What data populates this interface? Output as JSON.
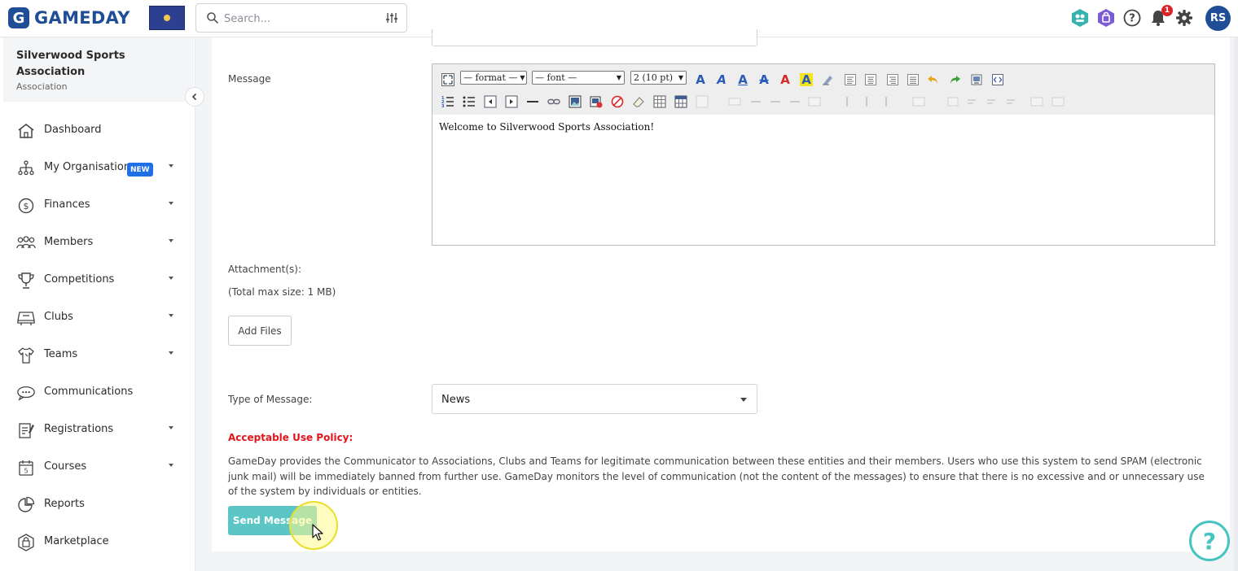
{
  "app": {
    "brand": "GAMEDAY",
    "search_placeholder": "Search...",
    "avatar_initials": "RS",
    "notification_count": "1"
  },
  "org": {
    "name": "Silverwood Sports Association",
    "type": "Association"
  },
  "nav": [
    {
      "label": "Dashboard",
      "icon": "home-icon",
      "has_caret": false
    },
    {
      "label": "My Organisation",
      "icon": "org-chart-icon",
      "has_caret": true,
      "badge": "NEW"
    },
    {
      "label": "Finances",
      "icon": "dollar-icon",
      "has_caret": true
    },
    {
      "label": "Members",
      "icon": "members-icon",
      "has_caret": true
    },
    {
      "label": "Competitions",
      "icon": "trophy-icon",
      "has_caret": true
    },
    {
      "label": "Clubs",
      "icon": "club-icon",
      "has_caret": true
    },
    {
      "label": "Teams",
      "icon": "shirt-icon",
      "has_caret": true
    },
    {
      "label": "Communications",
      "icon": "chat-icon",
      "has_caret": false
    },
    {
      "label": "Registrations",
      "icon": "registration-icon",
      "has_caret": true
    },
    {
      "label": "Courses",
      "icon": "calendar-icon",
      "has_caret": true
    },
    {
      "label": "Reports",
      "icon": "pie-chart-icon",
      "has_caret": false
    },
    {
      "label": "Marketplace",
      "icon": "shopping-bag-icon",
      "has_caret": false
    }
  ],
  "form": {
    "message_label": "Message",
    "editor": {
      "format_select": "— format —",
      "font_select": "— font —",
      "size_select": "2 (10 pt)",
      "content": "Welcome to Silverwood Sports Association!"
    },
    "attachments_label": "Attachment(s):",
    "max_size_note": "(Total max size: 1 MB)",
    "add_files_label": "Add Files",
    "type_label": "Type of Message:",
    "type_value": "News",
    "policy_title": "Acceptable Use Policy:",
    "policy_text": "GameDay provides the Communicator to Associations, Clubs and Teams for legitimate communication between these entities and their members. Users who use this system to send SPAM (electronic junk mail) will be immediately banned from further use. GameDay monitors the level of communication (not the content of the messages) to ensure that there is no excessive and or unnecessary use of the system by individuals or entities.",
    "send_label": "Send Message"
  },
  "colors": {
    "brand": "#1f4e96",
    "accent": "#5cc6c6",
    "danger": "#e3141b",
    "help": "#46c4c0"
  }
}
